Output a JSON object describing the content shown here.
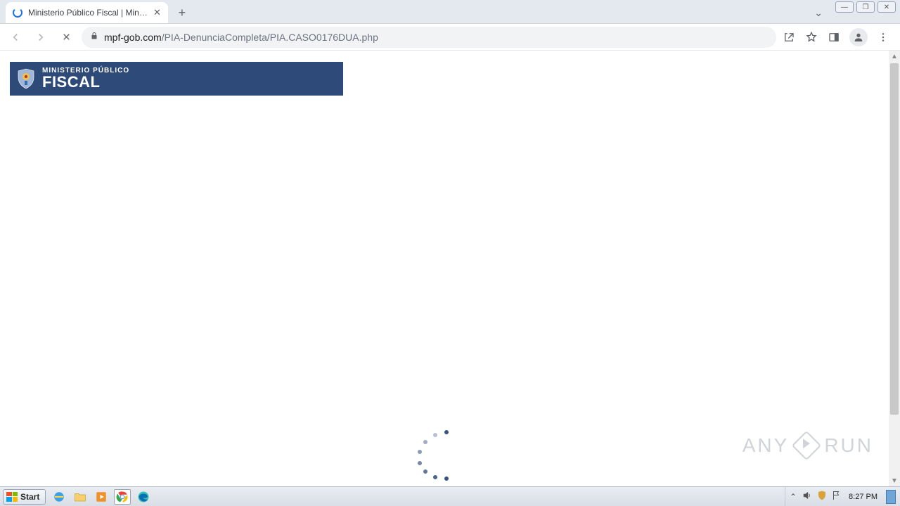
{
  "browser": {
    "tab_title": "Ministerio Público Fiscal | Ministerio P",
    "new_tab": "+",
    "url_host": "mpf-gob.com",
    "url_path": "/PIA-DenunciaCompleta/PIA.CASO0176DUA.php"
  },
  "page": {
    "banner_line1": "MINISTERIO PÚBLICO",
    "banner_line2": "FISCAL"
  },
  "watermark": {
    "left": "ANY",
    "right": "RUN"
  },
  "taskbar": {
    "start": "Start",
    "clock": "8:27 PM"
  },
  "colors": {
    "banner_bg": "#2d4a78"
  }
}
